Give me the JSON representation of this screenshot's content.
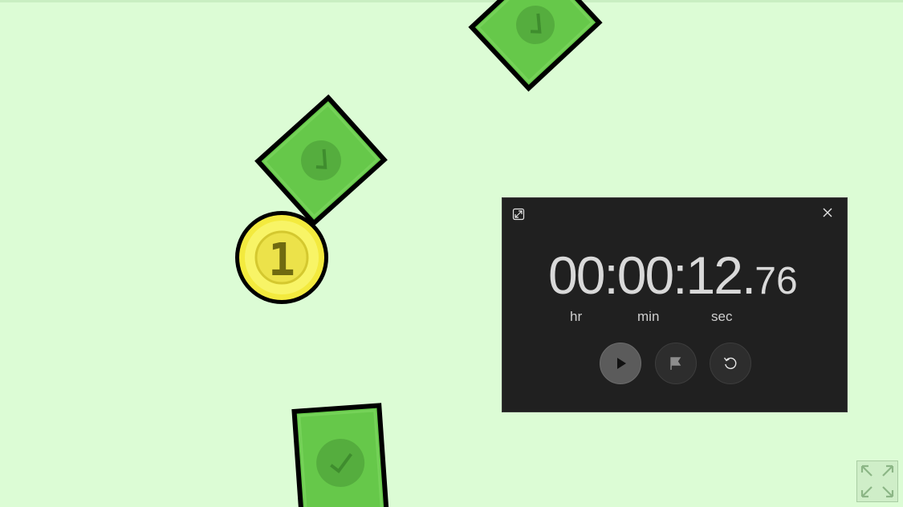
{
  "stopwatch": {
    "time_main": "00:00:12.",
    "time_fraction": "76",
    "unit_hr": "hr",
    "unit_min": "min",
    "unit_sec": "sec",
    "icons": {
      "expand": "expand-icon",
      "close": "close-icon",
      "play": "play-icon",
      "lap": "flag-icon",
      "reset": "reset-icon"
    }
  },
  "game": {
    "coin_value": "1",
    "cards": [
      "green-card",
      "green-card",
      "green-card"
    ],
    "fullscreen_icon": "fullscreen-arrows-icon"
  },
  "colors": {
    "background": "#dcfcd5",
    "card_green": "#66c84a",
    "coin_yellow": "#f7f04a",
    "widget_bg": "#202020"
  }
}
